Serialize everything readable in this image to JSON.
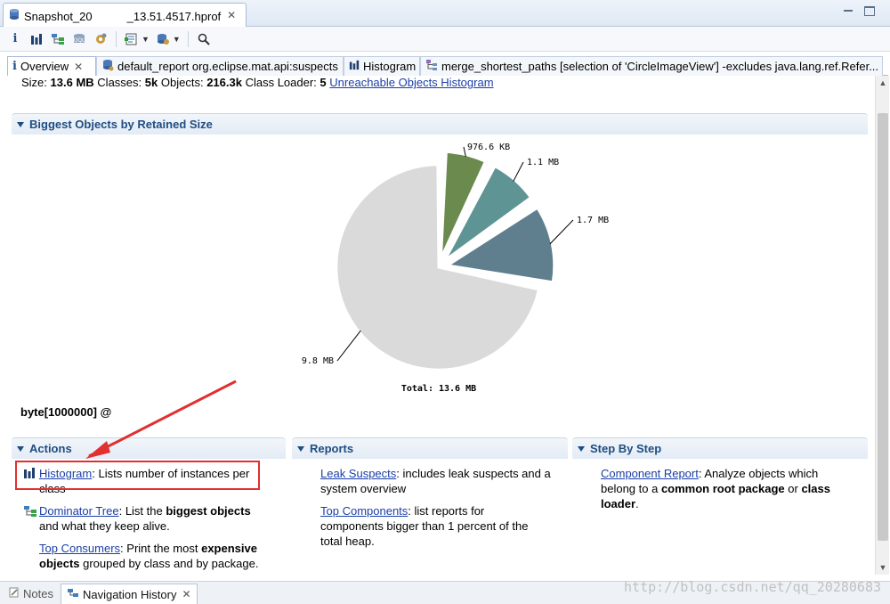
{
  "editor": {
    "tab_title": "Snapshot_20　　　_13.51.4517.hprof"
  },
  "view_tabs": [
    {
      "label": "Overview"
    },
    {
      "label": "default_report  org.eclipse.mat.api:suspects"
    },
    {
      "label": "Histogram"
    },
    {
      "label": "merge_shortest_paths [selection of 'CircleImageView'] -excludes java.lang.ref.Refer..."
    }
  ],
  "summary": {
    "size_label": "Size:",
    "size_value": "13.6 MB",
    "classes_label": "Classes:",
    "classes_value": "5k",
    "objects_label": "Objects:",
    "objects_value": "216.3k",
    "loader_label": "Class Loader:",
    "loader_value": "5",
    "unreachable_link": "Unreachable Objects Histogram"
  },
  "biggest_objects": {
    "header": "Biggest Objects by Retained Size",
    "selected_object": "byte[1000000] @"
  },
  "chart_data": {
    "type": "pie",
    "total_label": "Total: 13.6 MB",
    "slices": [
      {
        "label": "976.6 KB",
        "value": 0.95,
        "color": "#6b8a4e"
      },
      {
        "label": "1.1 MB",
        "value": 1.1,
        "color": "#5f9494"
      },
      {
        "label": "1.7 MB",
        "value": 1.7,
        "color": "#5f7f8f"
      },
      {
        "label": "9.8 MB",
        "value": 9.8,
        "color": "#dadada"
      }
    ]
  },
  "actions": {
    "header": "Actions",
    "items": [
      {
        "link": "Histogram",
        "text1": ": Lists number of instances per",
        "text2": "class"
      },
      {
        "link": "Dominator Tree",
        "text1": ": List the ",
        "bold1": "biggest objects",
        "text2": "and what they keep alive."
      },
      {
        "link": "Top Consumers",
        "text1": ": Print the most ",
        "bold1": "expensive",
        "bold2": "objects",
        "text2": " grouped by class and by package."
      }
    ]
  },
  "reports": {
    "header": "Reports",
    "items": [
      {
        "link": "Leak Suspects",
        "text1": ": includes leak suspects and a",
        "text2": "system overview"
      },
      {
        "link": "Top Components",
        "text1": ": list reports for",
        "text2": "components bigger than 1 percent of the",
        "text3": "total heap."
      }
    ]
  },
  "step_by_step": {
    "header": "Step By Step",
    "item": {
      "link": "Component Report",
      "text1": ": Analyze objects which",
      "text2a": "belong to a ",
      "bold1": "common root package",
      "text2b": " or ",
      "bold2": "class",
      "bold3": "loader",
      "text3": "."
    }
  },
  "bottom_tabs": [
    {
      "label": "Notes"
    },
    {
      "label": "Navigation History"
    }
  ],
  "watermark": "http://blog.csdn.net/qq_20280683",
  "colors": {
    "highlight_box": "#e03030",
    "section_header_text": "#1f4d82",
    "link": "#1a3fa8"
  }
}
